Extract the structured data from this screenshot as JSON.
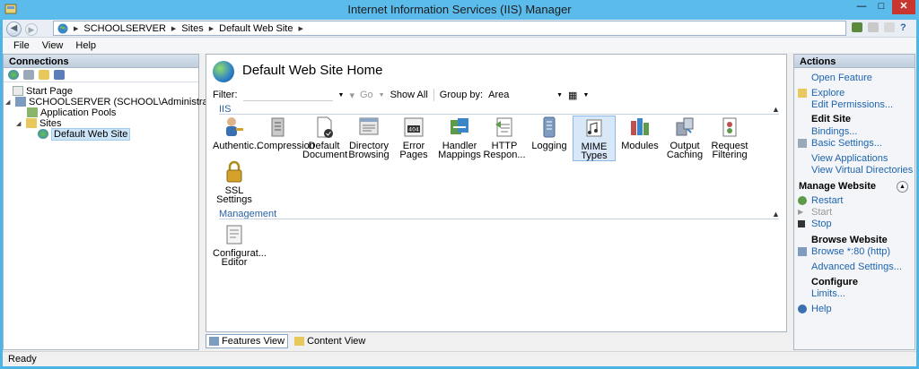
{
  "window": {
    "title": "Internet Information Services (IIS) Manager",
    "min": "—",
    "max": "□",
    "close": "✕"
  },
  "address": {
    "crumbs": [
      "SCHOOLSERVER",
      "Sites",
      "Default Web Site"
    ],
    "help": "?"
  },
  "menu": {
    "file": "File",
    "view": "View",
    "help": "Help"
  },
  "connections": {
    "title": "Connections",
    "tree": {
      "start": "Start Page",
      "server": "SCHOOLSERVER (SCHOOL\\Administrator)",
      "pools": "Application Pools",
      "sites": "Sites",
      "site": "Default Web Site"
    }
  },
  "main": {
    "title": "Default Web Site Home",
    "filter_label": "Filter:",
    "go": "Go",
    "show_all": "Show All",
    "group_by": "Group by:",
    "group_value": "Area",
    "group_iis": "IIS",
    "group_mgmt": "Management",
    "features": {
      "auth": [
        "Authentic..."
      ],
      "compression": [
        "Compression"
      ],
      "default_doc": [
        "Default",
        "Document"
      ],
      "dir_browsing": [
        "Directory",
        "Browsing"
      ],
      "error_pages": [
        "Error Pages"
      ],
      "handler": [
        "Handler",
        "Mappings"
      ],
      "http_resp": [
        "HTTP",
        "Respon..."
      ],
      "logging": [
        "Logging"
      ],
      "mime": [
        "MIME Types"
      ],
      "modules": [
        "Modules"
      ],
      "output": [
        "Output",
        "Caching"
      ],
      "request": [
        "Request",
        "Filtering"
      ],
      "ssl": [
        "SSL Settings"
      ],
      "config": [
        "Configurat...",
        "Editor"
      ]
    },
    "features_view": "Features View",
    "content_view": "Content View"
  },
  "actions": {
    "title": "Actions",
    "open_feature": "Open Feature",
    "explore": "Explore",
    "edit_permissions": "Edit Permissions...",
    "edit_site": "Edit Site",
    "bindings": "Bindings...",
    "basic_settings": "Basic Settings...",
    "view_apps": "View Applications",
    "view_vdirs": "View Virtual Directories",
    "manage_website": "Manage Website",
    "restart": "Restart",
    "start": "Start",
    "stop": "Stop",
    "browse_website": "Browse Website",
    "browse_80": "Browse *:80 (http)",
    "advanced": "Advanced Settings...",
    "configure": "Configure",
    "limits": "Limits...",
    "help": "Help"
  },
  "status": {
    "text": "Ready"
  },
  "colors": {
    "titlebar": "#5bbcec",
    "link": "#1d64b0",
    "accent_blue": "#2a62a8",
    "close": "#c7372f"
  }
}
